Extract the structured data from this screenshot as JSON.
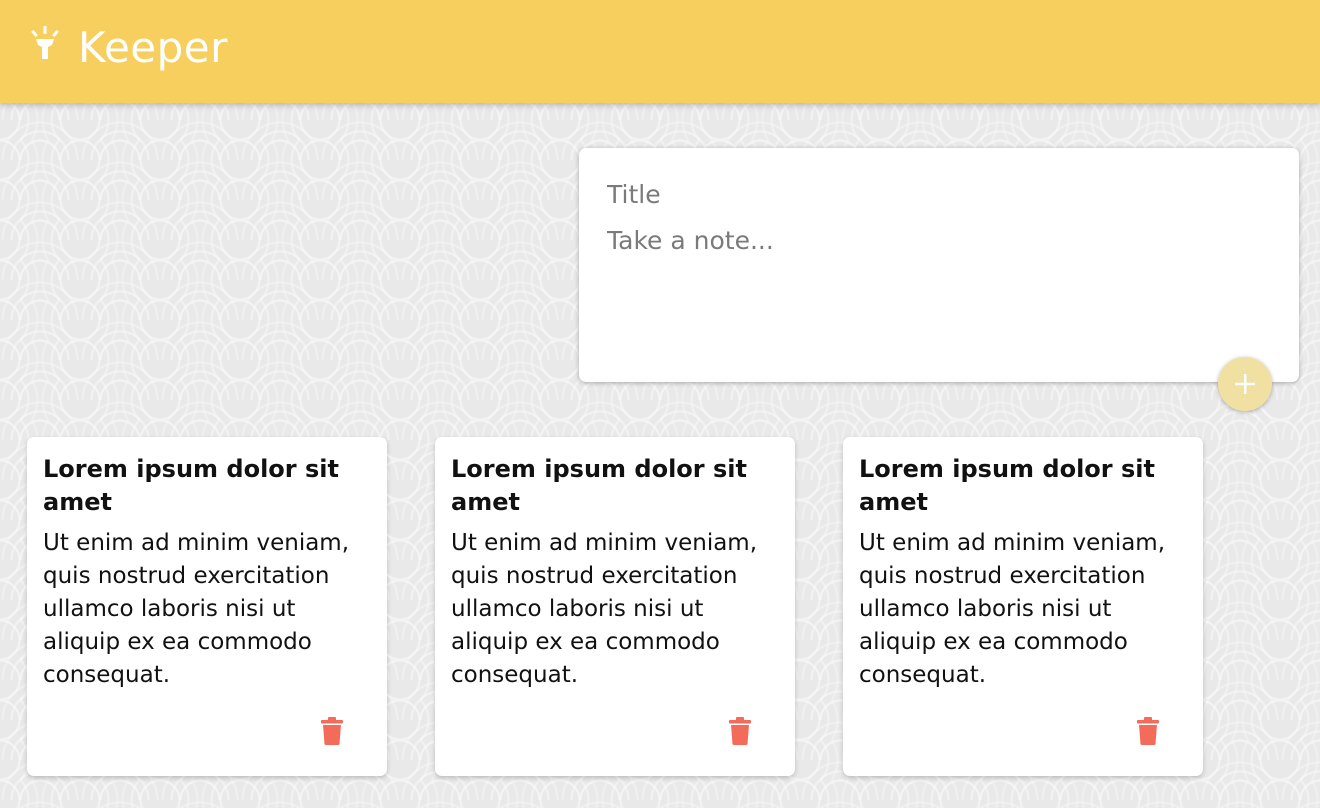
{
  "header": {
    "title": "Keeper",
    "icon": "flashlight-icon"
  },
  "create": {
    "title_placeholder": "Title",
    "content_placeholder": "Take a note...",
    "add_icon": "plus-icon"
  },
  "notes": [
    {
      "title": "Lorem ipsum dolor sit amet",
      "content": "Ut enim ad minim veniam, quis nostrud exercitation ullamco laboris nisi ut aliquip ex ea commodo consequat.",
      "delete_icon": "trash-icon"
    },
    {
      "title": "Lorem ipsum dolor sit amet",
      "content": "Ut enim ad minim veniam, quis nostrud exercitation ullamco laboris nisi ut aliquip ex ea commodo consequat.",
      "delete_icon": "trash-icon"
    },
    {
      "title": "Lorem ipsum dolor sit amet",
      "content": "Ut enim ad minim veniam, quis nostrud exercitation ullamco laboris nisi ut aliquip ex ea commodo consequat.",
      "delete_icon": "trash-icon"
    }
  ],
  "colors": {
    "header": "#f7cf5f",
    "add_button": "#f0e1a2",
    "delete": "#f26b5b",
    "background": "#e9e9e9"
  }
}
